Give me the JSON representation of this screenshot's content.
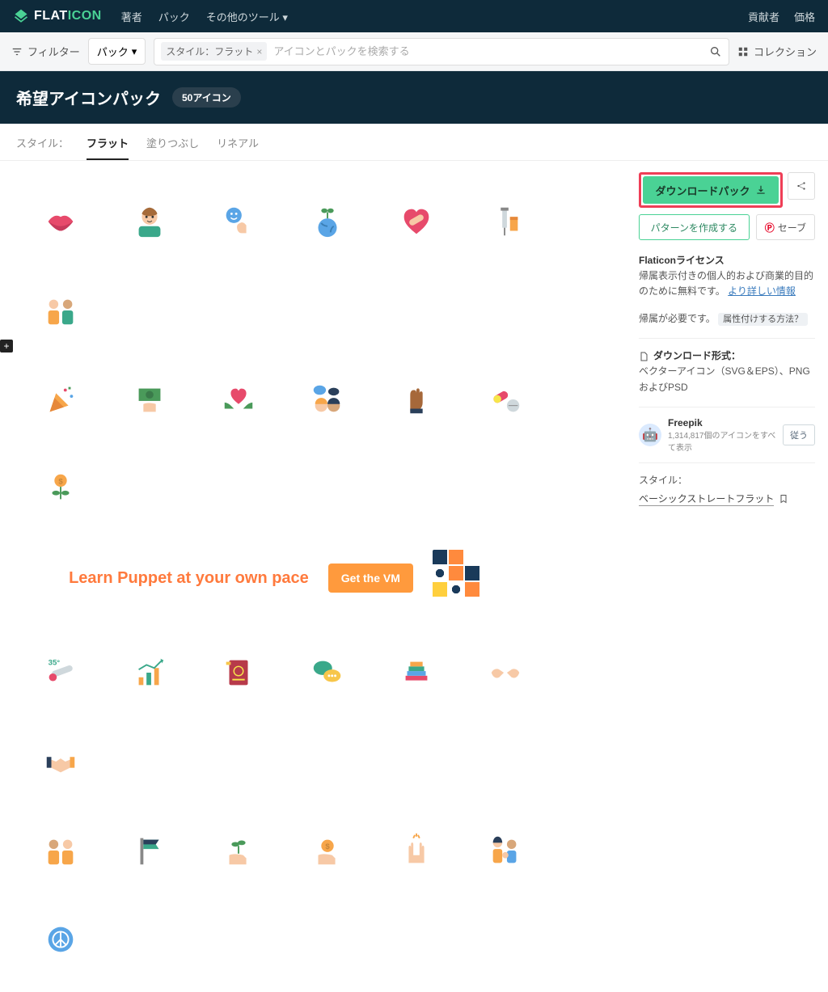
{
  "nav": {
    "logo_white": "FLAT",
    "logo_green": "ICON",
    "links": [
      "著者",
      "パック",
      "その他のツール"
    ],
    "right": [
      "貢献者",
      "価格"
    ]
  },
  "searchbar": {
    "filter": "フィルター",
    "pack_dd": "パック",
    "chip": "スタイル：フラット",
    "placeholder": "アイコンとパックを検索する",
    "collection": "コレクション"
  },
  "title": {
    "heading": "希望アイコンパック",
    "count": "50アイコン"
  },
  "tabs": {
    "label": "スタイル：",
    "items": [
      "フラット",
      "塗りつぶし",
      "リネアル"
    ],
    "active": 0
  },
  "icons_row1": [
    "lips",
    "boy",
    "emoji-wave",
    "sprout-globe",
    "heart-bandage",
    "syringe",
    "couple"
  ],
  "icons_row2": [
    "confetti",
    "cash-hand",
    "hands-heart",
    "faces-speech",
    "fist-raised",
    "pills",
    "coin-flower"
  ],
  "icons_row3": [
    "thermometer",
    "bar-growth",
    "passport",
    "chat-bubbles",
    "books",
    "fist-bump",
    "handshake"
  ],
  "icons_row4": [
    "couple2",
    "flag",
    "hand-plant",
    "hand-coin",
    "high-five",
    "family",
    "peace-globe"
  ],
  "ad": {
    "text": "Learn Puppet at your own pace",
    "cta": "Get the VM"
  },
  "sidebar": {
    "download": "ダウンロードパック",
    "pattern": "パターンを作成する",
    "save": "セーブ",
    "license_h": "Flaticonライセンス",
    "license_t": "帰属表示付きの個人的および商業的目的のために無料です。",
    "more_info": "より詳しい情報",
    "attrib_t": "帰属が必要です。",
    "attrib_link": "属性付けする方法？",
    "format_h": "ダウンロード形式：",
    "format_t": "ベクターアイコン（SVG＆EPS）、PNGおよびPSD",
    "author_name": "Freepik",
    "author_count": "1,314,817個のアイコンをすべて表示",
    "follow": "従う",
    "style_label": "スタイル：",
    "style_link": "ベーシックストレートフラット"
  }
}
